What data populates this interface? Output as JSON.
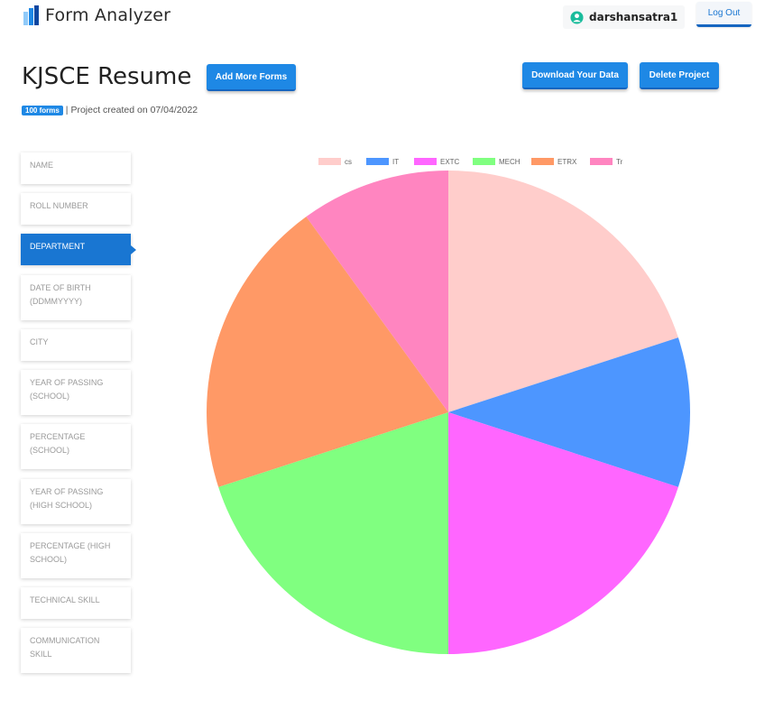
{
  "header": {
    "app_title": "Form Analyzer",
    "username": "darshansatra1",
    "logout_label": "Log Out"
  },
  "project": {
    "title": "KJSCE Resume",
    "add_forms_label": "Add More Forms",
    "download_label": "Download Your Data",
    "delete_label": "Delete Project",
    "forms_badge": "100 forms",
    "created_text": "| Project created on 07/04/2022"
  },
  "sidebar": {
    "items": [
      {
        "label": "NAME",
        "active": false
      },
      {
        "label": "ROLL NUMBER",
        "active": false
      },
      {
        "label": "DEPARTMENT",
        "active": true
      },
      {
        "label": "DATE OF BIRTH (DDMMYYYY)",
        "active": false
      },
      {
        "label": "CITY",
        "active": false
      },
      {
        "label": "YEAR OF PASSING (SCHOOL)",
        "active": false
      },
      {
        "label": "PERCENTAGE (SCHOOL)",
        "active": false
      },
      {
        "label": "YEAR OF PASSING (HIGH SCHOOL)",
        "active": false
      },
      {
        "label": "PERCENTAGE (HIGH SCHOOL)",
        "active": false
      },
      {
        "label": "TECHNICAL SKILL",
        "active": false
      },
      {
        "label": "COMMUNICATION SKILL",
        "active": false
      }
    ]
  },
  "colors": {
    "accent": "#1e88e5",
    "active_item": "#1976d2"
  },
  "chart_data": {
    "type": "pie",
    "title": "",
    "categories": [
      "cs",
      "IT",
      "EXTC",
      "MECH",
      "ETRX",
      "Tr"
    ],
    "values": [
      20,
      10,
      20,
      20,
      20,
      10
    ],
    "colors": [
      "#ffcdcb",
      "#4d96ff",
      "#ff66ff",
      "#80ff80",
      "#ff9966",
      "#ff85c0"
    ],
    "legend_position": "top"
  }
}
